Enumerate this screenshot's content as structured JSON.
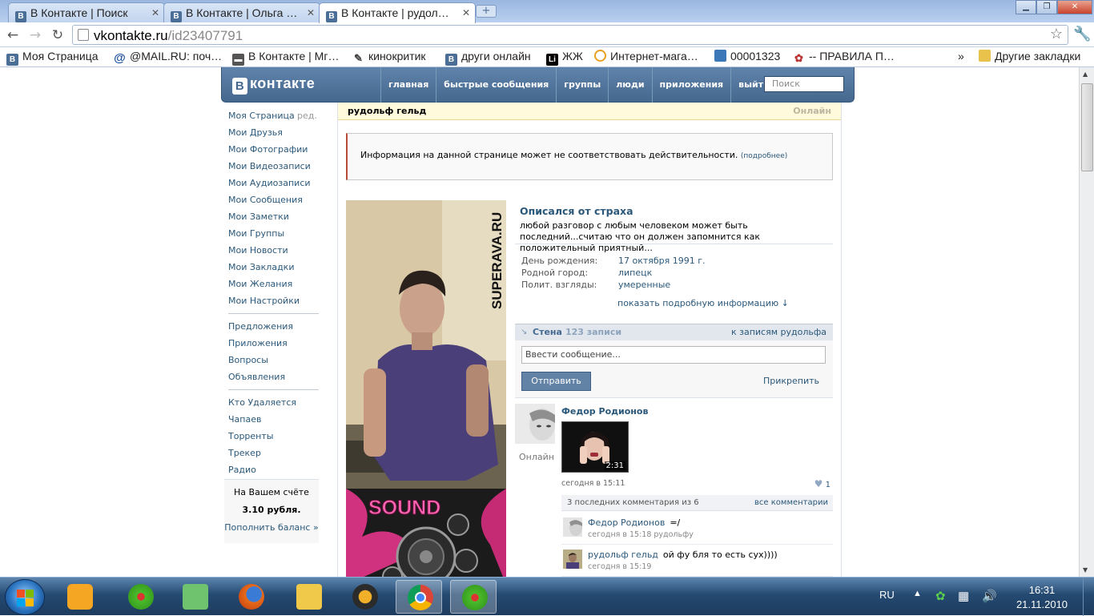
{
  "browser": {
    "tabs": [
      {
        "label": "В Контакте | Поиск",
        "active": false
      },
      {
        "label": "В Контакте | Ольга …",
        "active": false
      },
      {
        "label": "В Контакте | рудол…",
        "active": true
      }
    ],
    "url_host": "vkontakte.ru",
    "url_path": "/id23407791",
    "bookmarks": [
      {
        "label": "Моя Страница",
        "icon": "vk-icon"
      },
      {
        "label": "@MAIL.RU: поч…",
        "icon": "mail-icon"
      },
      {
        "label": "В Контакте | Мг…",
        "icon": "chat-icon"
      },
      {
        "label": "кинокритик",
        "icon": "pen-icon"
      },
      {
        "label": "други онлайн",
        "icon": "vk-icon"
      },
      {
        "label": "ЖЖ",
        "icon": "li-icon"
      },
      {
        "label": "Интернет-мага…",
        "icon": "shop-icon"
      },
      {
        "label": "00001323",
        "icon": "image-icon"
      },
      {
        "label": "-- ПРАВИЛА П…",
        "icon": "flower-icon"
      }
    ],
    "bookmarks_other": "Другие закладки"
  },
  "vk": {
    "logo": "контакте",
    "logo_letter": "В",
    "nav": [
      "главная",
      "быстрые сообщения",
      "группы",
      "люди",
      "приложения",
      "выйти"
    ],
    "search_placeholder": "Поиск",
    "left_menu": {
      "group1": [
        "Моя Страница",
        "Мои Друзья",
        "Мои Фотографии",
        "Мои Видеозаписи",
        "Мои Аудиозаписи",
        "Мои Сообщения",
        "Мои Заметки",
        "Мои Группы",
        "Мои Новости",
        "Мои Закладки",
        "Мои Желания",
        "Мои Настройки"
      ],
      "edit": "ред.",
      "group2": [
        "Предложения",
        "Приложения",
        "Вопросы",
        "Объявления"
      ],
      "group3": [
        "Кто Удаляется",
        "Чапаев",
        "Торренты",
        "Трекер",
        "Радио"
      ]
    },
    "balance": {
      "title": "На Вашем счёте",
      "sum": "3.10 рубля.",
      "link": "Пополнить баланс »"
    },
    "profile": {
      "name": "рудольф гельд",
      "online": "Онлайн",
      "warning": "Информация на данной странице может не соответствовать действительности.",
      "warning_more": "(подробнее)",
      "photo_watermark": "SUPERAVA.RU",
      "photo_sound": "SOUND",
      "status_title": "Описался от страха",
      "status_text": "любой разговор с любым человеком может быть последний...считаю что он должен запомнится как положительный приятный...",
      "info": [
        {
          "key": "День рождения:",
          "value": "17 октября 1991 г."
        },
        {
          "key": "Родной город:",
          "value": "липецк"
        },
        {
          "key": "Полит. взгляды:",
          "value": "умеренные"
        }
      ],
      "show_more": "показать подробную информацию ↓"
    },
    "wall": {
      "title": "Стена",
      "count": "123 записи",
      "to_posts": "к записям рудольфа",
      "input_placeholder": "Ввести сообщение...",
      "send": "Отправить",
      "attach": "Прикрепить",
      "post": {
        "author": "Федор Родионов",
        "online": "Онлайн",
        "video_duration": "2:31",
        "date": "сегодня в 15:11",
        "likes": "1",
        "comments_header": "3 последних комментария из 6",
        "all_comments": "все комментарии",
        "comments": [
          {
            "name": "Федор Родионов",
            "text": "=/",
            "date": "сегодня в 15:18 рудольфу"
          },
          {
            "name": "рудольф гельд",
            "text": "ой фу бля то есть сух))))",
            "date": "сегодня в 15:19"
          }
        ]
      }
    }
  },
  "taskbar": {
    "lang": "RU",
    "time": "16:31",
    "date": "21.11.2010"
  }
}
